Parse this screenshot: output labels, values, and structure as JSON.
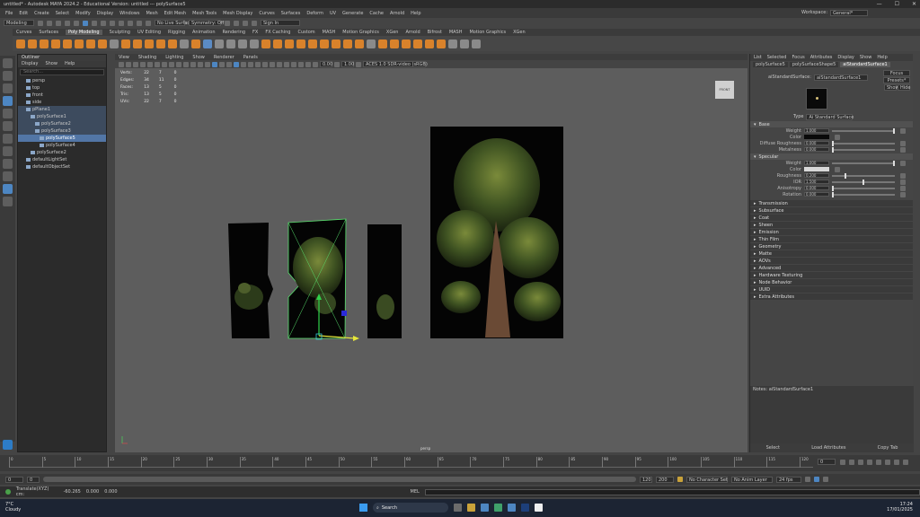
{
  "window": {
    "title": "untitled* - Autodesk MAYA 2024.2 - Educational Version: untitled --- polySurface5",
    "controls": [
      "—",
      "☐",
      "✕"
    ]
  },
  "menubar": {
    "items": [
      "File",
      "Edit",
      "Create",
      "Select",
      "Modify",
      "Display",
      "Windows",
      "Mesh",
      "Edit Mesh",
      "Mesh Tools",
      "Mesh Display",
      "Curves",
      "Surfaces",
      "Deform",
      "UV",
      "Generate",
      "Cache",
      "Arnold",
      "Help"
    ],
    "workspace_label": "Workspace:",
    "workspace_value": "General*"
  },
  "statusline": {
    "mode": "Modeling",
    "live_surface": "No Live Surface",
    "symmetry": "Symmetry: Off",
    "sign_in": "Sign In"
  },
  "shelf": {
    "tabs": [
      "Curves",
      "Surfaces",
      "Poly Modeling",
      "Sculpting",
      "UV Editing",
      "Rigging",
      "Animation",
      "Rendering",
      "FX",
      "FX Caching",
      "Custom",
      "MASH",
      "Motion Graphics",
      "XGen",
      "Arnold",
      "Bifrost",
      "MASH",
      "Motion Graphics",
      "XGen"
    ],
    "active_tab": "Poly Modeling"
  },
  "outliner": {
    "title": "Outliner",
    "menus": [
      "Display",
      "Show",
      "Help"
    ],
    "search_placeholder": "Search...",
    "items": [
      {
        "label": "persp",
        "indent": 1,
        "state": ""
      },
      {
        "label": "top",
        "indent": 1,
        "state": ""
      },
      {
        "label": "front",
        "indent": 1,
        "state": ""
      },
      {
        "label": "side",
        "indent": 1,
        "state": ""
      },
      {
        "label": "pPlane1",
        "indent": 1,
        "state": "hl"
      },
      {
        "label": "polySurface1",
        "indent": 2,
        "state": "hl"
      },
      {
        "label": "polySurface2",
        "indent": 3,
        "state": "hl"
      },
      {
        "label": "polySurface3",
        "indent": 3,
        "state": "hl"
      },
      {
        "label": "polySurface5",
        "indent": 4,
        "state": "sel"
      },
      {
        "label": "polySurface4",
        "indent": 4,
        "state": ""
      },
      {
        "label": "polySurface2",
        "indent": 2,
        "state": ""
      },
      {
        "label": "defaultLightSet",
        "indent": 1,
        "state": ""
      },
      {
        "label": "defaultObjectSet",
        "indent": 1,
        "state": ""
      }
    ]
  },
  "viewport": {
    "menus": [
      "View",
      "Shading",
      "Lighting",
      "Show",
      "Renderer",
      "Panels"
    ],
    "num1": "0.00",
    "num2": "1.00",
    "colorspace": "ACES 1.0 SDR-video (sRGB)",
    "hud": {
      "rows": [
        {
          "label": "Verts:",
          "a": "22",
          "b": "7",
          "c": "0"
        },
        {
          "label": "Edges:",
          "a": "34",
          "b": "11",
          "c": "0"
        },
        {
          "label": "Faces:",
          "a": "13",
          "b": "5",
          "c": "0"
        },
        {
          "label": "Tris:",
          "a": "13",
          "b": "5",
          "c": "0"
        },
        {
          "label": "UVs:",
          "a": "22",
          "b": "7",
          "c": "0"
        }
      ]
    },
    "camera": "persp",
    "viewcube": "FRONT"
  },
  "attribute_editor": {
    "menus": [
      "List",
      "Selected",
      "Focus",
      "Attributes",
      "Display",
      "Show",
      "Help"
    ],
    "tabs": [
      "polySurface5",
      "polySurfaceShape5",
      "aiStandardSurface1"
    ],
    "active_tab": "aiStandardSurface1",
    "node_label": "aiStandardSurface:",
    "node_name": "aiStandardSurface1",
    "buttons": [
      "Focus",
      "Presets*",
      "Show",
      "Hide"
    ],
    "type_label": "Type",
    "type_value": "Ai Standard Surface",
    "base_section": "Base",
    "base_rows": [
      {
        "label": "Weight",
        "value": "1.000",
        "knob": 100
      },
      {
        "label": "Color",
        "value": "",
        "swatch": "#0a0a0a"
      },
      {
        "label": "Diffuse Roughness",
        "value": "0.000",
        "knob": 0
      },
      {
        "label": "Metalness",
        "value": "0.000",
        "knob": 0
      }
    ],
    "specular_section": "Specular",
    "spec_rows": [
      {
        "label": "Weight",
        "value": "1.000",
        "knob": 100
      },
      {
        "label": "Color",
        "value": "",
        "swatch": "#d8d8d8"
      },
      {
        "label": "Roughness",
        "value": "0.200",
        "knob": 20
      },
      {
        "label": "IOR",
        "value": "1.500",
        "knob": 50
      },
      {
        "label": "Anisotropy",
        "value": "0.000",
        "knob": 0
      },
      {
        "label": "Rotation",
        "value": "0.000",
        "knob": 0
      }
    ],
    "collapsed_sections": [
      "Transmission",
      "Subsurface",
      "Coat",
      "Sheen",
      "Emission",
      "Thin Film",
      "Geometry",
      "Matte",
      "AOVs",
      "Advanced",
      "Hardware Texturing",
      "Node Behavior",
      "UUID",
      "Extra Attributes"
    ],
    "notes_label": "Notes: aiStandardSurface1",
    "bottom_buttons": [
      "Select",
      "Load Attributes",
      "Copy Tab"
    ]
  },
  "timeline": {
    "ticks": [
      "0",
      "5",
      "10",
      "15",
      "20",
      "25",
      "30",
      "35",
      "40",
      "45",
      "50",
      "55",
      "60",
      "65",
      "70",
      "75",
      "80",
      "85",
      "90",
      "95",
      "100",
      "105",
      "110",
      "115",
      "120"
    ],
    "current_frame": "0",
    "range_start": "0",
    "range_inner_start": "0",
    "range_end_inner": "120",
    "range_end": "200",
    "fps": "24 fps",
    "character_set": "No Character Set",
    "anim_layer": "No Anim Layer"
  },
  "cmdline": {
    "mode": "MEL",
    "readout_label": "Translate(XYZ) cm:",
    "x": "-60.265",
    "y": "0.000",
    "z": "0.000"
  },
  "taskbar": {
    "weather_temp": "7°C",
    "weather_desc": "Cloudy",
    "search": "Search",
    "time": "17:24",
    "date": "17/01/2025"
  }
}
